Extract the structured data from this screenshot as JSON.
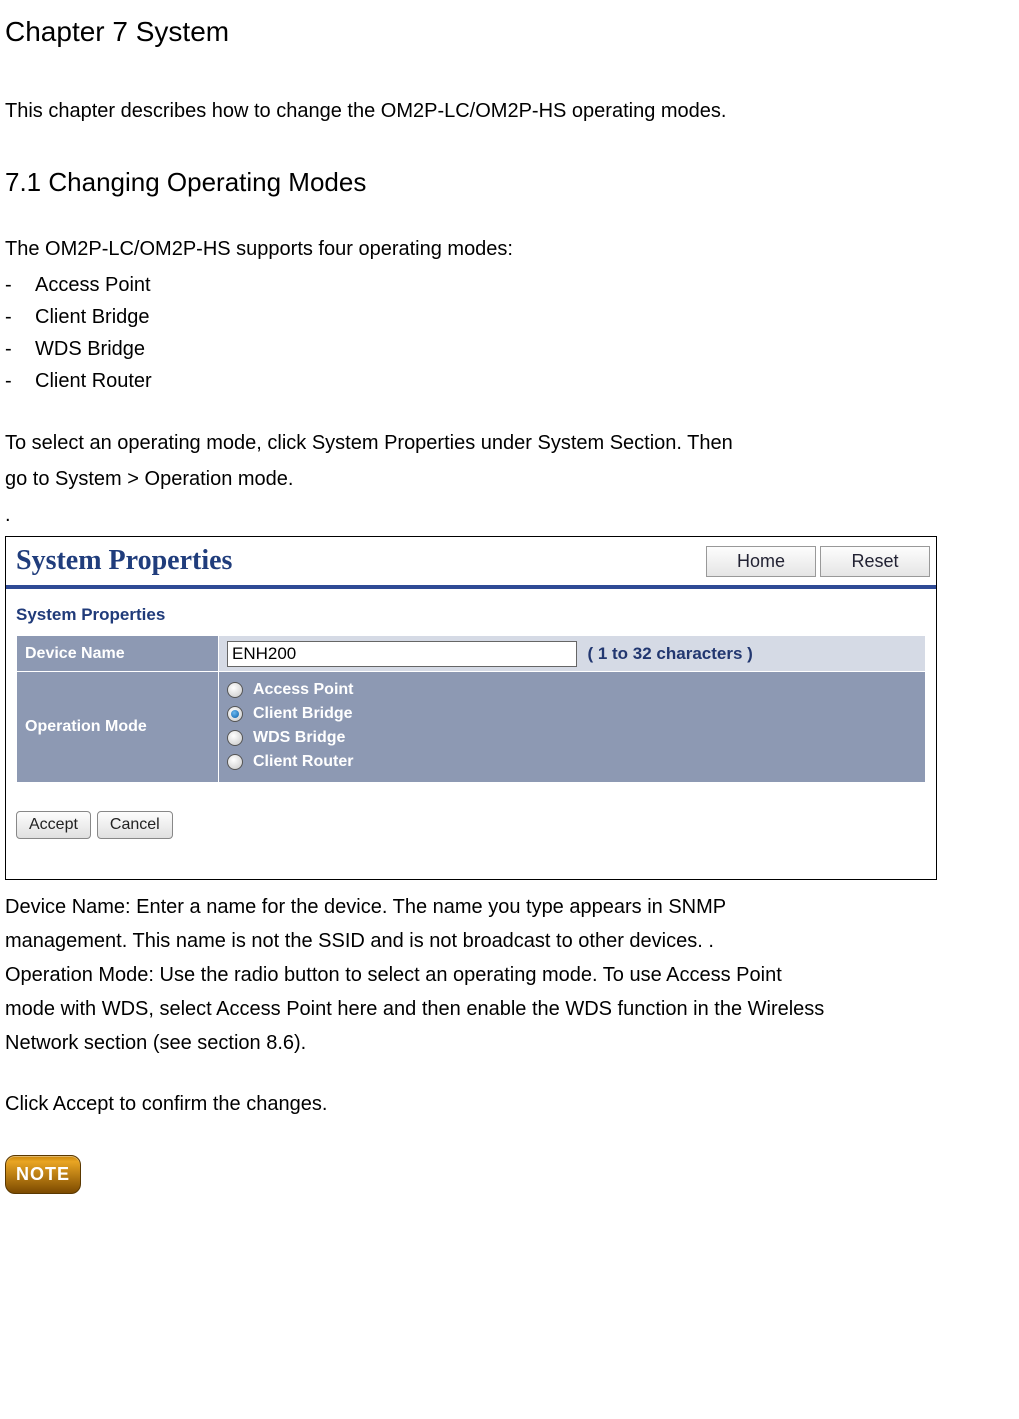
{
  "chapter_title": "Chapter 7 System",
  "intro": "This chapter describes how to change the OM2P-LC/OM2P-HS operating modes.",
  "section_heading": "7.1 Changing  Operating Modes",
  "supports_text": "The OM2P-LC/OM2P-HS supports four operating modes:",
  "modes": [
    "Access Point",
    "Client Bridge",
    "WDS Bridge",
    "Client Router"
  ],
  "select_instruction_1": "To select an operating mode, click System Properties under System Section. Then",
  "select_instruction_2": "go to System > Operation mode.",
  "dot": ".",
  "panel": {
    "title": "System Properties",
    "home_btn": "Home",
    "reset_btn": "Reset",
    "section_label": "System Properties",
    "device_name_label": "Device Name",
    "device_name_value": "ENH200",
    "chars_hint": "( 1 to 32 characters )",
    "operation_mode_label": "Operation Mode",
    "radios": [
      {
        "label": "Access Point",
        "selected": false
      },
      {
        "label": "Client Bridge",
        "selected": true
      },
      {
        "label": "WDS Bridge",
        "selected": false
      },
      {
        "label": "Client Router",
        "selected": false
      }
    ],
    "accept_btn": "Accept",
    "cancel_btn": "Cancel"
  },
  "desc": {
    "line1": "Device Name: Enter a name for the device. The name you type appears in SNMP",
    "line2": "management. This name is not the SSID and is not broadcast to other devices. .",
    "line3": "Operation Mode: Use the radio button to select an operating mode. To use Access Point",
    "line4": "mode with WDS, select Access Point here and then enable the WDS function in the Wireless",
    "line5": "Network section (see section 8.6)."
  },
  "confirm": "Click Accept to confirm the changes.",
  "note_badge": "NOTE"
}
